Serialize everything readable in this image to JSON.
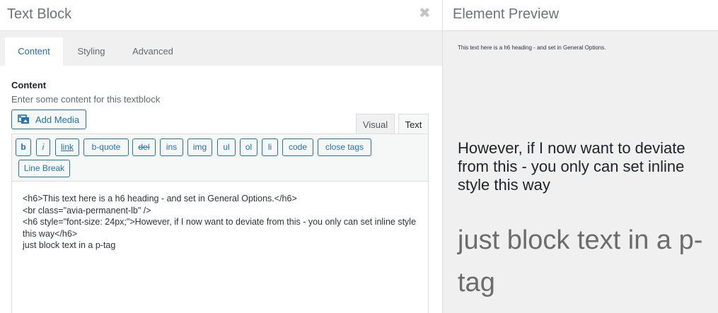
{
  "header": {
    "title": "Text Block",
    "close_icon": "close-icon"
  },
  "tabs": [
    {
      "label": "Content",
      "active": true
    },
    {
      "label": "Styling",
      "active": false
    },
    {
      "label": "Advanced",
      "active": false
    }
  ],
  "field": {
    "label": "Content",
    "description": "Enter some content for this textblock"
  },
  "add_media": {
    "label": "Add Media",
    "icon": "add-media-icon"
  },
  "editor_modes": {
    "visual": "Visual",
    "text": "Text",
    "active": "Text"
  },
  "quicktags": {
    "b": "b",
    "i": "i",
    "link": "link",
    "bquote": "b-quote",
    "del": "del",
    "ins": "ins",
    "img": "img",
    "ul": "ul",
    "ol": "ol",
    "li": "li",
    "code": "code",
    "close_tags": "close tags",
    "line_break": "Line Break"
  },
  "editor": {
    "content": "<h6>This text here is a h6 heading - and set in General Options.</h6>\n<br class=\"avia-permanent-lb\" />\n<h6 style=\"font-size: 24px;\">However, if I now want to deviate from this - you only can set inline style this way</h6>\njust block text in a p-tag"
  },
  "preview": {
    "title": "Element Preview",
    "h6_text": "This text here is a h6 heading - and set in General Options.",
    "h6_big_text": "However, if I now want to deviate from this - you only can set inline style this way",
    "p_text": "just block text in a p-tag"
  },
  "colors": {
    "accent": "#2271b1",
    "panel_bg": "#f0f0f1",
    "preview_heading": "#1d2327",
    "preview_paragraph": "#6c6c6c"
  }
}
